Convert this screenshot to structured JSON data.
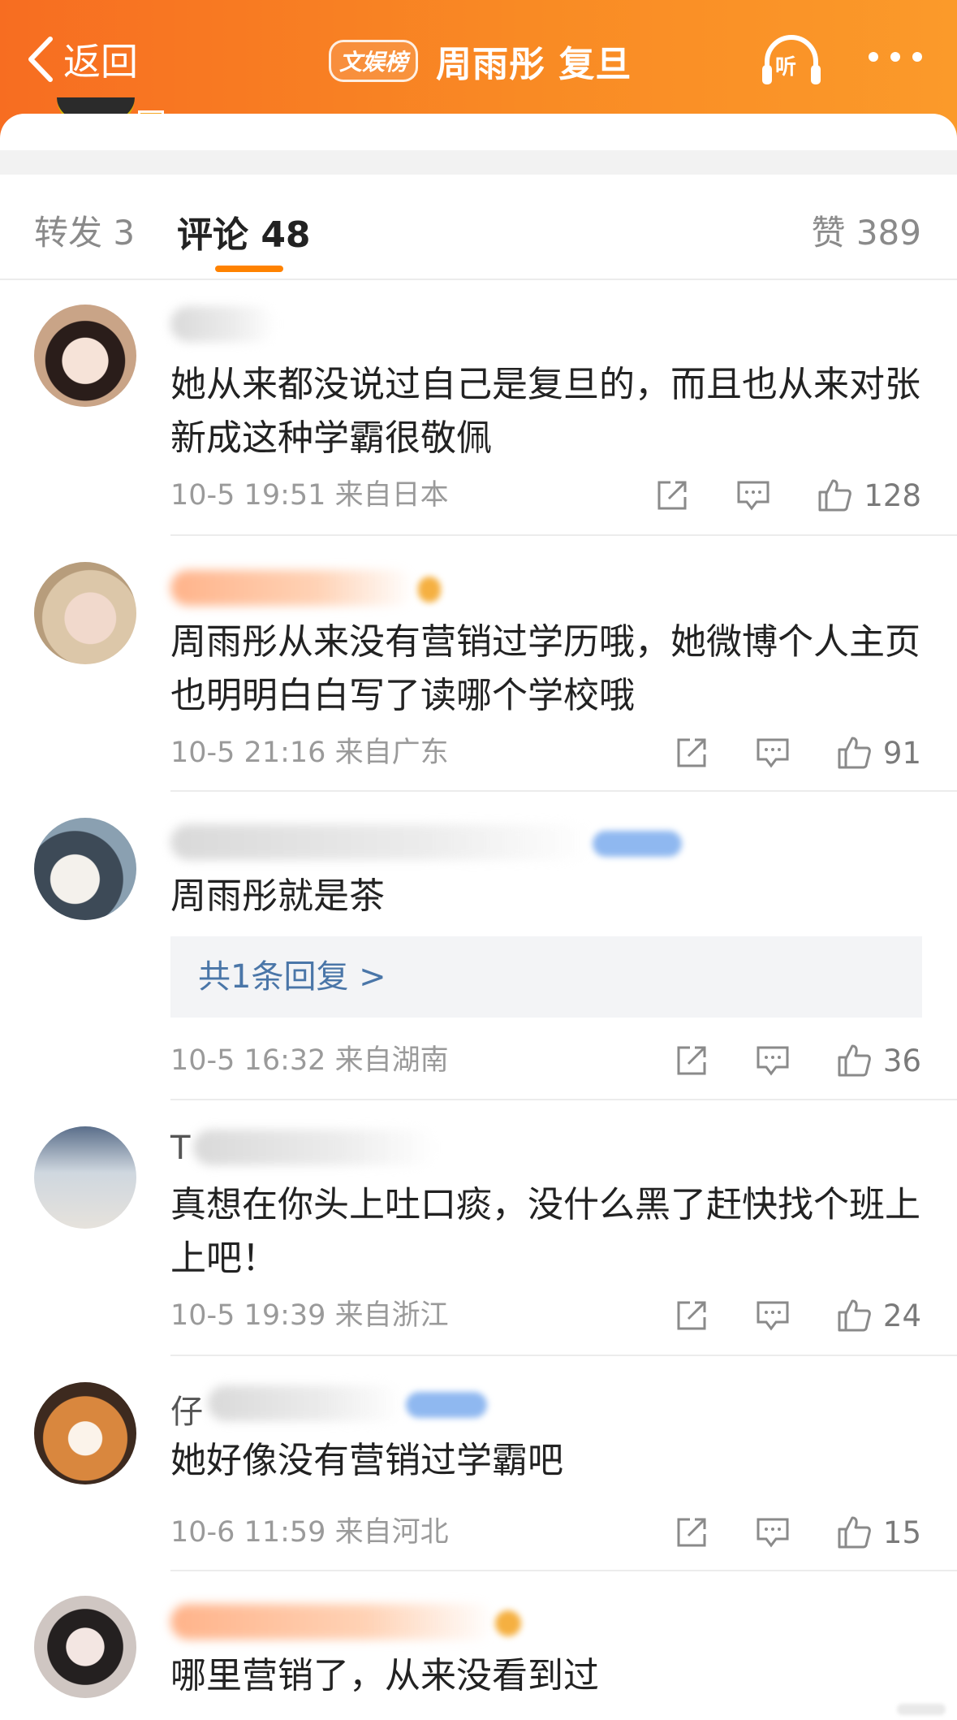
{
  "header": {
    "back_label": "返回",
    "badge": "文娱榜",
    "title": "周雨彤 复旦",
    "listen_label": "听"
  },
  "tabs": {
    "repost": "转发 3",
    "comment": "评论 48",
    "like": "赞 389"
  },
  "colors": {
    "brand": "#f98a24",
    "accent": "#ff8200",
    "link": "#4a76a8"
  },
  "comments": [
    {
      "username_visible": "",
      "text": "她从来都没说过自己是复旦的，而且也从来对张新成这种学霸很敬佩",
      "time": "10-5 19:51",
      "location": "来自日本",
      "likes": "128"
    },
    {
      "username_visible": "",
      "text": "周雨彤从来没有营销过学历哦，她微博个人主页也明明白白写了读哪个学校哦",
      "time": "10-5 21:16",
      "location": "来自广东",
      "likes": "91"
    },
    {
      "username_visible": "",
      "text": "周雨彤就是茶",
      "reply": "共1条回复 >",
      "time": "10-5 16:32",
      "location": "来自湖南",
      "likes": "36"
    },
    {
      "username_visible": "T",
      "text": "真想在你头上吐口痰，没什么黑了赶快找个班上上吧！",
      "time": "10-5 19:39",
      "location": "来自浙江",
      "likes": "24"
    },
    {
      "username_visible": "仔",
      "text": "她好像没有营销过学霸吧",
      "time": "10-6 11:59",
      "location": "来自河北",
      "likes": "15"
    },
    {
      "username_visible": "",
      "text": "哪里营销了，从来没看到过"
    }
  ]
}
